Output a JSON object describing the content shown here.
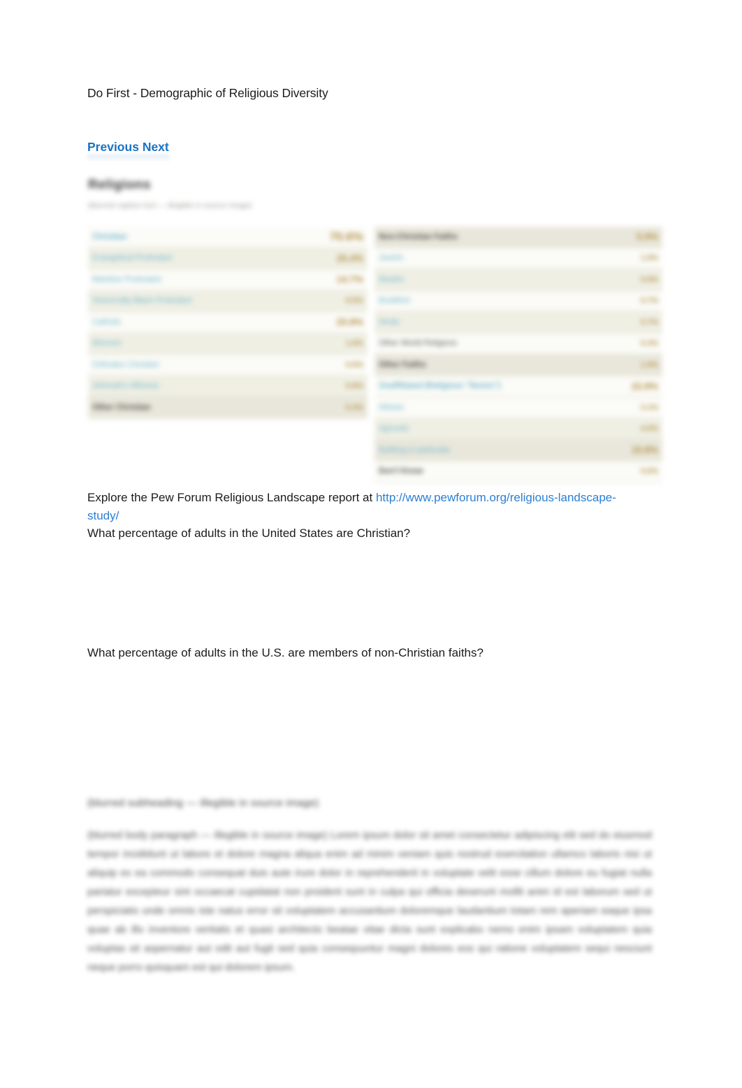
{
  "document": {
    "title": "Do First - Demographic of Religious Diversity"
  },
  "nav": {
    "previous_label": "Previous",
    "next_label": "Next",
    "separator": " "
  },
  "figure": {
    "heading": "Religions",
    "subheading": "(blurred caption text — illegible in source image)",
    "left_table": {
      "rows": [
        {
          "label": "Christian",
          "value": "70.6%",
          "level": 0,
          "style": "row-white",
          "value_size": "val-big"
        },
        {
          "label": "Evangelical Protestant",
          "value": "25.4%",
          "level": 1,
          "style": "row-beige",
          "value_size": "val-mid"
        },
        {
          "label": "Mainline Protestant",
          "value": "14.7%",
          "level": 1,
          "style": "row-white",
          "value_size": "val-mid"
        },
        {
          "label": "Historically Black Protestant",
          "value": "6.5%",
          "level": 1,
          "style": "row-beige",
          "value_size": "val-small"
        },
        {
          "label": "Catholic",
          "value": "20.8%",
          "level": 1,
          "style": "row-white",
          "value_size": "val-mid"
        },
        {
          "label": "Mormon",
          "value": "1.6%",
          "level": 1,
          "style": "row-beige",
          "value_size": "val-small"
        },
        {
          "label": "Orthodox Christian",
          "value": "0.5%",
          "level": 1,
          "style": "row-white",
          "value_size": "val-small"
        },
        {
          "label": "Jehovah's Witness",
          "value": "0.8%",
          "level": 1,
          "style": "row-beige",
          "value_size": "val-small"
        },
        {
          "label": "Other Christian",
          "value": "0.4%",
          "level": "head",
          "style": "row-head",
          "value_size": "val-small"
        }
      ]
    },
    "right_table": {
      "rows": [
        {
          "label": "Non-Christian Faiths",
          "value": "5.9%",
          "level": "head",
          "style": "row-head",
          "value_size": "val-mid"
        },
        {
          "label": "Jewish",
          "value": "1.9%",
          "level": 1,
          "style": "row-white",
          "value_size": "val-small"
        },
        {
          "label": "Muslim",
          "value": "0.9%",
          "level": 1,
          "style": "row-beige",
          "value_size": "val-small"
        },
        {
          "label": "Buddhist",
          "value": "0.7%",
          "level": 1,
          "style": "row-white",
          "value_size": "val-small"
        },
        {
          "label": "Hindu",
          "value": "0.7%",
          "level": 1,
          "style": "row-beige",
          "value_size": "val-small"
        },
        {
          "label": "Other World Religions",
          "value": "0.3%",
          "level": "sub",
          "style": "row-white",
          "value_size": "val-small"
        },
        {
          "label": "Other Faiths",
          "value": "1.5%",
          "level": "head",
          "style": "row-head",
          "value_size": "val-small"
        },
        {
          "label": "Unaffiliated (Religious \"Nones\")",
          "value": "22.8%",
          "level": 0,
          "style": "row-white",
          "value_size": "val-mid"
        },
        {
          "label": "Atheist",
          "value": "3.1%",
          "level": 1,
          "style": "row-white",
          "value_size": "val-small"
        },
        {
          "label": "Agnostic",
          "value": "4.0%",
          "level": 1,
          "style": "row-beige",
          "value_size": "val-small"
        },
        {
          "label": "Nothing in particular",
          "value": "15.8%",
          "level": 1,
          "style": "row-head",
          "value_size": "val-mid"
        },
        {
          "label": "Don't Know",
          "value": "0.6%",
          "level": "head",
          "style": "row-white",
          "value_size": "val-small"
        }
      ]
    }
  },
  "content": {
    "explore_prefix": "Explore the Pew Forum Religious Landscape report at ",
    "explore_url_text": "http://www.pewforum.org/religious-landscape-study/",
    "question_1": "What percentage of adults in the United States are Christian?",
    "question_2": "What percentage of adults in the U.S. are members of non-Christian faiths?"
  },
  "article": {
    "heading": "(blurred subheading — illegible in source image)",
    "body": "(blurred body paragraph — illegible in source image) Lorem ipsum dolor sit amet consectetur adipiscing elit sed do eiusmod tempor incididunt ut labore et dolore magna aliqua enim ad minim veniam quis nostrud exercitation ullamco laboris nisi ut aliquip ex ea commodo consequat duis aute irure dolor in reprehenderit in voluptate velit esse cillum dolore eu fugiat nulla pariatur excepteur sint occaecat cupidatat non proident sunt in culpa qui officia deserunt mollit anim id est laborum sed ut perspiciatis unde omnis iste natus error sit voluptatem accusantium doloremque laudantium totam rem aperiam eaque ipsa quae ab illo inventore veritatis et quasi architecto beatae vitae dicta sunt explicabo nemo enim ipsam voluptatem quia voluptas sit aspernatur aut odit aut fugit sed quia consequuntur magni dolores eos qui ratione voluptatem sequi nesciunt neque porro quisquam est qui dolorem ipsum."
  },
  "colors": {
    "link_blue": "#2b7fd4",
    "nav_blue": "#1a72c4",
    "table_teal": "#67b2c9",
    "table_gold": "#b8964a",
    "row_beige": "#efefe4"
  }
}
